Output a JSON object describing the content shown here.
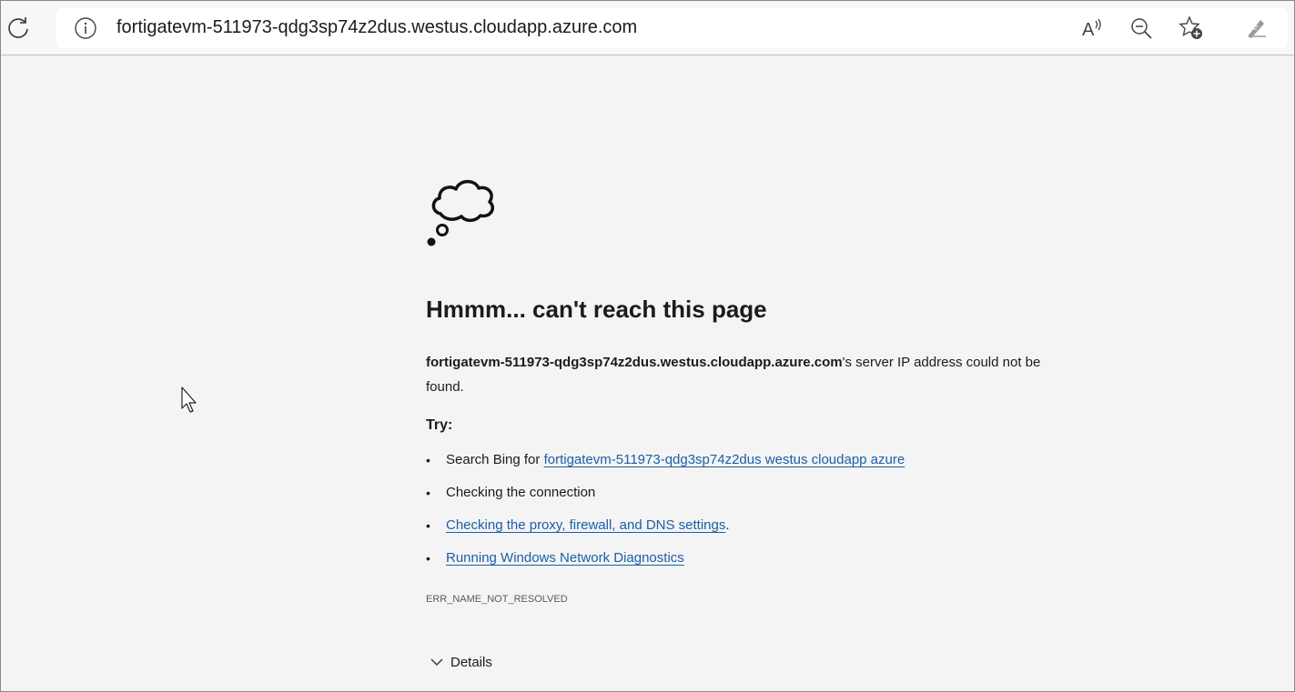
{
  "toolbar": {
    "reload_icon": "reload-icon",
    "site_info_icon": "info-icon",
    "url": "fortigatevm-511973-qdg3sp74z2dus.westus.cloudapp.azure.com",
    "read_aloud_icon": "read-aloud-icon",
    "zoom_out_icon": "zoom-out-icon",
    "add_favorite_icon": "star-add-icon",
    "extensions_icon": "pen-icon"
  },
  "error_page": {
    "illustration": "thought-cloud-icon",
    "title": "Hmmm... can't reach this page",
    "host": "fortigatevm-511973-qdg3sp74z2dus.westus.cloudapp.azure.com",
    "message_suffix": "'s server IP address could not be found.",
    "try_label": "Try:",
    "suggestions": {
      "search_prefix": "Search Bing for ",
      "search_link": "fortigatevm-511973-qdg3sp74z2dus westus cloudapp azure",
      "check_connection": "Checking the connection",
      "proxy_link": "Checking the proxy, firewall, and DNS settings",
      "proxy_suffix": ".",
      "diagnostics_link": "Running Windows Network Diagnostics"
    },
    "error_code": "ERR_NAME_NOT_RESOLVED",
    "details_label": "Details"
  },
  "colors": {
    "link": "#1a5fa8",
    "page_bg": "#f4f4f4",
    "text": "#1b1b1b"
  }
}
